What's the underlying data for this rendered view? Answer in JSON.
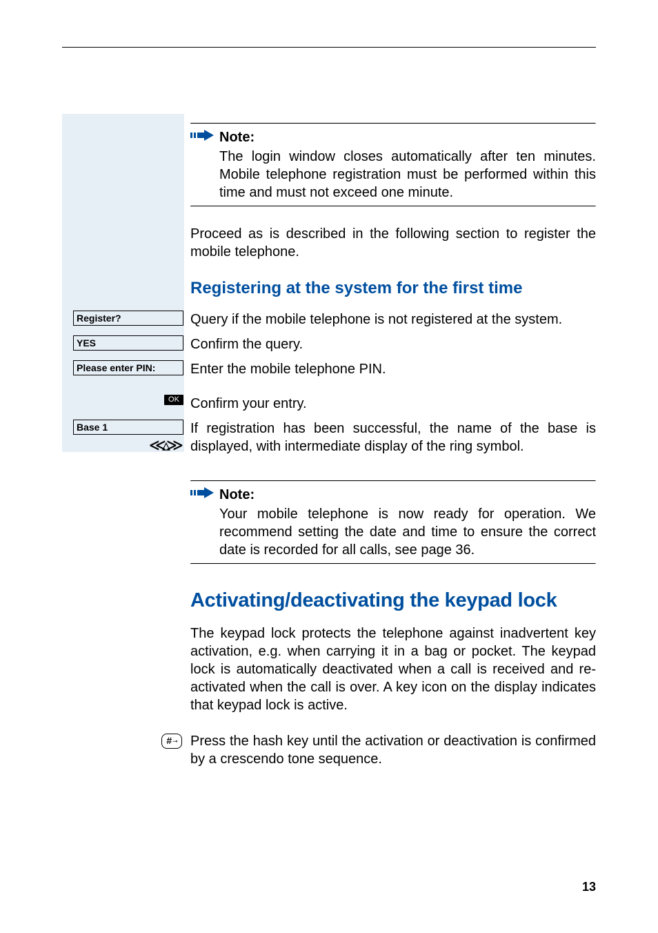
{
  "page_number": "13",
  "note1": {
    "label": "Note:",
    "body": "The login window closes automatically after ten minutes. Mobile telephone registration must be performed within this time and must not exceed one minute."
  },
  "proceed_text": "Proceed as is described in the following section to register the mobile telephone.",
  "heading_register": "Registering at the system for the first time",
  "steps": {
    "register": {
      "label": "Register?",
      "text": "Query if the mobile telephone is not registered at the system."
    },
    "yes": {
      "label": "YES",
      "text": "Confirm the query."
    },
    "pin": {
      "label": "Please enter PIN:",
      "text": "Enter the mobile telephone PIN."
    },
    "ok": {
      "label": "OK",
      "text": "Confirm your entry."
    },
    "base": {
      "label": "Base 1",
      "text": "If registration has been successful, the name of the base is displayed, with intermediate display of the ring symbol."
    }
  },
  "note2": {
    "label": "Note:",
    "body": "Your mobile telephone is now ready for operation. We recommend setting the date and time to ensure the correct date is recorded for all calls, see page 36."
  },
  "heading_keypad": "Activating/deactivating the keypad lock",
  "keypad_intro": "The keypad lock protects the telephone against inadvertent key activation, e.g. when carrying it in a bag or pocket. The keypad lock is automatically deactivated when a call is received and re-activated when the call is over. A key icon on the display indicates that keypad lock is active.",
  "hash_step": {
    "key": "#",
    "text": "Press the hash key until the activation or deactivation is confirmed by a crescendo tone sequence."
  }
}
